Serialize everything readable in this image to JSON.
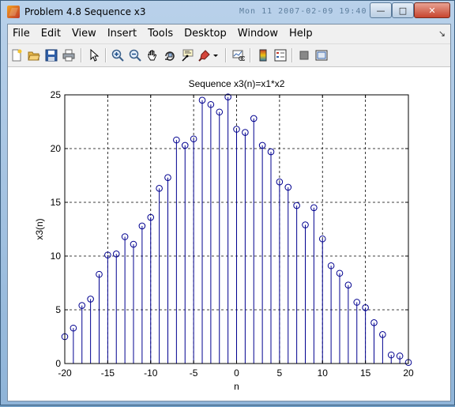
{
  "window": {
    "title": "Problem 4.8 Sequence x3",
    "background_text": "Mon 11  2007-02-09 19:40"
  },
  "menu": {
    "items": [
      "File",
      "Edit",
      "View",
      "Insert",
      "Tools",
      "Desktop",
      "Window",
      "Help"
    ]
  },
  "toolbar": {
    "buttons": [
      "new-figure-icon",
      "open-file-icon",
      "save-icon",
      "print-icon",
      "edit-plot-arrow-icon",
      "zoom-in-icon",
      "zoom-out-icon",
      "pan-hand-icon",
      "rotate-3d-icon",
      "data-cursor-icon",
      "brush-icon",
      "brush-dropdown-icon",
      "link-plot-icon",
      "colorbar-icon",
      "legend-icon",
      "hide-plot-tools-icon",
      "show-plot-tools-icon"
    ]
  },
  "colors": {
    "stem": "#00008f",
    "grid": "#000000",
    "axes_bg": "#ffffff"
  },
  "chart_data": {
    "type": "stem",
    "title": "Sequence x3(n)=x1*x2",
    "xlabel": "n",
    "ylabel": "x3(n)",
    "xlim": [
      -20,
      20
    ],
    "ylim": [
      0,
      25
    ],
    "xticks": [
      -20,
      -15,
      -10,
      -5,
      0,
      5,
      10,
      15,
      20
    ],
    "yticks": [
      0,
      5,
      10,
      15,
      20,
      25
    ],
    "grid": true,
    "x": [
      -20,
      -19,
      -18,
      -17,
      -16,
      -15,
      -14,
      -13,
      -12,
      -11,
      -10,
      -9,
      -8,
      -7,
      -6,
      -5,
      -4,
      -3,
      -2,
      -1,
      0,
      1,
      2,
      3,
      4,
      5,
      6,
      7,
      8,
      9,
      10,
      11,
      12,
      13,
      14,
      15,
      16,
      17,
      18,
      19,
      20
    ],
    "values": [
      2.5,
      3.3,
      5.4,
      6.0,
      8.3,
      10.1,
      10.2,
      11.8,
      11.1,
      12.8,
      13.6,
      16.3,
      17.3,
      20.8,
      20.3,
      20.9,
      24.5,
      24.1,
      23.4,
      24.8,
      21.8,
      21.5,
      22.8,
      20.3,
      19.7,
      16.9,
      16.4,
      14.7,
      12.9,
      14.5,
      11.6,
      9.1,
      8.4,
      7.3,
      5.7,
      5.2,
      3.8,
      2.7,
      0.8,
      0.7,
      0.1
    ]
  }
}
